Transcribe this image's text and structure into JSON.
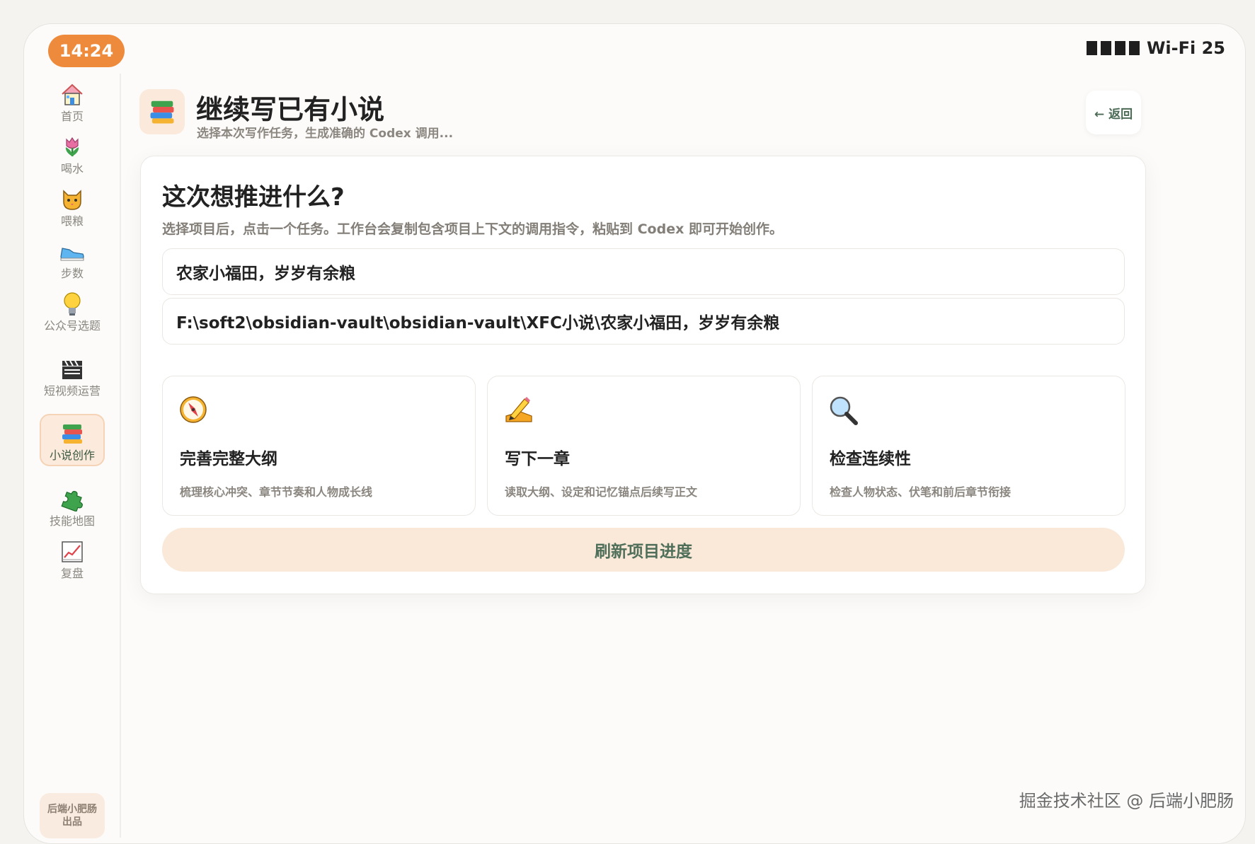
{
  "status": {
    "time": "14:24",
    "network": "Wi-Fi 25"
  },
  "sidebar": {
    "items": [
      {
        "label": "首页",
        "icon": "house-icon"
      },
      {
        "label": "喝水",
        "icon": "tulip-icon"
      },
      {
        "label": "喂粮",
        "icon": "cat-icon"
      },
      {
        "label": "步数",
        "icon": "sneaker-icon"
      },
      {
        "label": "公众号选题",
        "icon": "lightbulb-icon"
      },
      {
        "label": "短视频运营",
        "icon": "clapper-icon"
      },
      {
        "label": "小说创作",
        "icon": "books-icon",
        "active": true
      },
      {
        "label": "技能地图",
        "icon": "puzzle-icon"
      },
      {
        "label": "复盘",
        "icon": "chart-icon"
      }
    ],
    "credit": "后端小肥肠出品"
  },
  "header": {
    "title": "继续写已有小说",
    "subtitle": "选择本次写作任务，生成准确的 Codex 调用...",
    "back_label": "← 返回"
  },
  "card": {
    "title": "这次想推进什么?",
    "description": "选择项目后，点击一个任务。工作台会复制包含项目上下文的调用指令，粘贴到 Codex 即可开始创作。",
    "project_name": "农家小福田，岁岁有余粮",
    "project_path": "F:\\soft2\\obsidian-vault\\obsidian-vault\\XFC小说\\农家小福田，岁岁有余粮",
    "tasks": [
      {
        "title": "完善完整大纲",
        "desc": "梳理核心冲突、章节节奏和人物成长线",
        "icon": "compass-icon"
      },
      {
        "title": "写下一章",
        "desc": "读取大纲、设定和记忆锚点后续写正文",
        "icon": "pencil-writing-icon"
      },
      {
        "title": "检查连续性",
        "desc": "检查人物状态、伏笔和前后章节衔接",
        "icon": "magnifier-icon"
      }
    ],
    "refresh_label": "刷新项目进度"
  },
  "watermark": "掘金技术社区 @ 后端小肥肠",
  "colors": {
    "accent": "#ee8a3c",
    "brand_green": "#4f6f5a",
    "soft_peach": "#fae8d8"
  }
}
